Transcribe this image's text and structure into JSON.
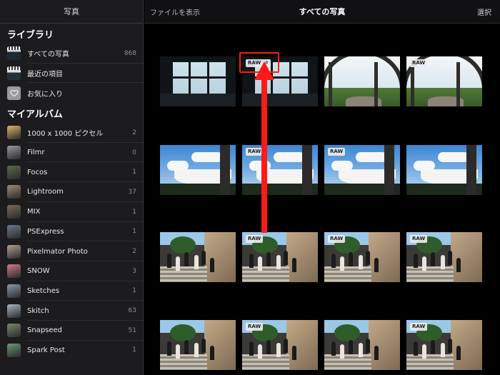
{
  "sidebar": {
    "header": "写真",
    "library_title": "ライブラリ",
    "library_items": [
      {
        "label": "すべての写真",
        "count": "868",
        "icon": "film-thumbnail"
      },
      {
        "label": "最近の項目",
        "count": "",
        "icon": "film-thumbnail"
      },
      {
        "label": "お気に入り",
        "count": "",
        "icon": "heart-icon"
      }
    ],
    "albums_title": "マイアルバム",
    "albums": [
      {
        "label": "1000 x 1000 ピクセル",
        "count": "2",
        "color": "#d8b36a"
      },
      {
        "label": "Filmr",
        "count": "0",
        "color": "#9a9a9e"
      },
      {
        "label": "Focos",
        "count": "1",
        "color": "#5a6b4a"
      },
      {
        "label": "Lightroom",
        "count": "37",
        "color": "#9c8a7a"
      },
      {
        "label": "MIX",
        "count": "1",
        "color": "#7a6a5a"
      },
      {
        "label": "PSExpress",
        "count": "1",
        "color": "#6a7a8a"
      },
      {
        "label": "Pixelmator Photo",
        "count": "2",
        "color": "#b0a090"
      },
      {
        "label": "SNOW",
        "count": "3",
        "color": "#d07a8a"
      },
      {
        "label": "Sketches",
        "count": "1",
        "color": "#8a9aa8"
      },
      {
        "label": "Skitch",
        "count": "63",
        "color": "#a8b4c0"
      },
      {
        "label": "Snapseed",
        "count": "51",
        "color": "#7a8a6a"
      },
      {
        "label": "Spark Post",
        "count": "1",
        "color": "#6a9a7a"
      }
    ]
  },
  "header": {
    "show_files": "ファイルを表示",
    "title": "すべての写真",
    "select": "選択"
  },
  "badge": {
    "raw": "RAW"
  },
  "photos": [
    {
      "scene": "window",
      "raw": false,
      "link": false
    },
    {
      "scene": "window",
      "raw": true,
      "link": true
    },
    {
      "scene": "canopy",
      "raw": false,
      "link": false
    },
    {
      "scene": "canopy",
      "raw": true,
      "link": false
    },
    {
      "scene": "sky",
      "raw": false,
      "link": false
    },
    {
      "scene": "sky",
      "raw": true,
      "link": false
    },
    {
      "scene": "sky",
      "raw": true,
      "link": false
    },
    {
      "scene": "sky",
      "raw": false,
      "link": false
    },
    {
      "scene": "stairs",
      "raw": false,
      "link": false
    },
    {
      "scene": "stairs",
      "raw": true,
      "link": false
    },
    {
      "scene": "stairs",
      "raw": true,
      "link": false
    },
    {
      "scene": "stairs",
      "raw": true,
      "link": false
    },
    {
      "scene": "stairs",
      "raw": false,
      "link": false
    },
    {
      "scene": "stairs",
      "raw": true,
      "link": false
    },
    {
      "scene": "stairs",
      "raw": false,
      "link": false
    },
    {
      "scene": "stairs",
      "raw": true,
      "link": false
    }
  ],
  "colors": {
    "annotation": "#ff1a1a",
    "sidebar_bg": "#1c1c1e",
    "main_bg": "#000000"
  }
}
